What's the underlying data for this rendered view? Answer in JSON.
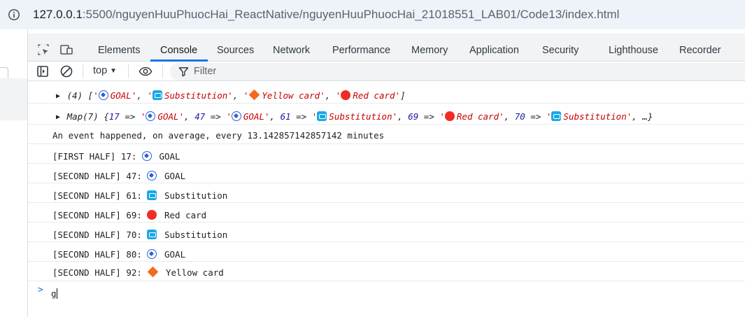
{
  "address_bar": {
    "host": "127.0.0.1",
    "path": ":5500/nguyenHuuPhuocHai_ReactNative/nguyenHuuPhuocHai_21018551_LAB01/Code13/index.html"
  },
  "devtools": {
    "tabs": [
      "Elements",
      "Console",
      "Sources",
      "Network",
      "Performance",
      "Memory",
      "Application",
      "Security",
      "Lighthouse",
      "Recorder"
    ],
    "active_tab": "Console",
    "context": "top",
    "filter_placeholder": "Filter"
  },
  "console": {
    "array_row": {
      "prefix": "(4) [",
      "items": [
        "'⚽ GOAL'",
        "'🔁 Substitution'",
        "'🔶 Yellow card'",
        "'🔴 Red card'"
      ],
      "labels": [
        "GOAL",
        "Substitution",
        "Yellow card",
        "Red card"
      ]
    },
    "map_row": {
      "prefix": "Map(7) {",
      "entries": [
        {
          "key": "17",
          "label": "GOAL"
        },
        {
          "key": "47",
          "label": "GOAL"
        },
        {
          "key": "61",
          "label": "Substitution"
        },
        {
          "key": "69",
          "label": "Red card"
        },
        {
          "key": "70",
          "label": "Substitution"
        }
      ],
      "suffix": "…}"
    },
    "average_line": "An event happened, on average, every 13.142857142857142 minutes",
    "events": [
      {
        "prefix": "[FIRST HALF] 17:",
        "icon": "soccer-ball-icon",
        "label": "GOAL"
      },
      {
        "prefix": "[SECOND HALF] 47:",
        "icon": "soccer-ball-icon",
        "label": "GOAL"
      },
      {
        "prefix": "[SECOND HALF] 61:",
        "icon": "substitution-icon",
        "label": "Substitution"
      },
      {
        "prefix": "[SECOND HALF] 69:",
        "icon": "red-circle-icon",
        "label": "Red card"
      },
      {
        "prefix": "[SECOND HALF] 70:",
        "icon": "substitution-icon",
        "label": "Substitution"
      },
      {
        "prefix": "[SECOND HALF] 80:",
        "icon": "soccer-ball-icon",
        "label": "GOAL"
      },
      {
        "prefix": "[SECOND HALF] 92:",
        "icon": "orange-diamond-icon",
        "label": "Yellow card"
      }
    ],
    "prompt_input": "g"
  },
  "colors": {
    "accent": "#1a73e8",
    "string": "#c80000",
    "number": "#1a1aa6"
  }
}
